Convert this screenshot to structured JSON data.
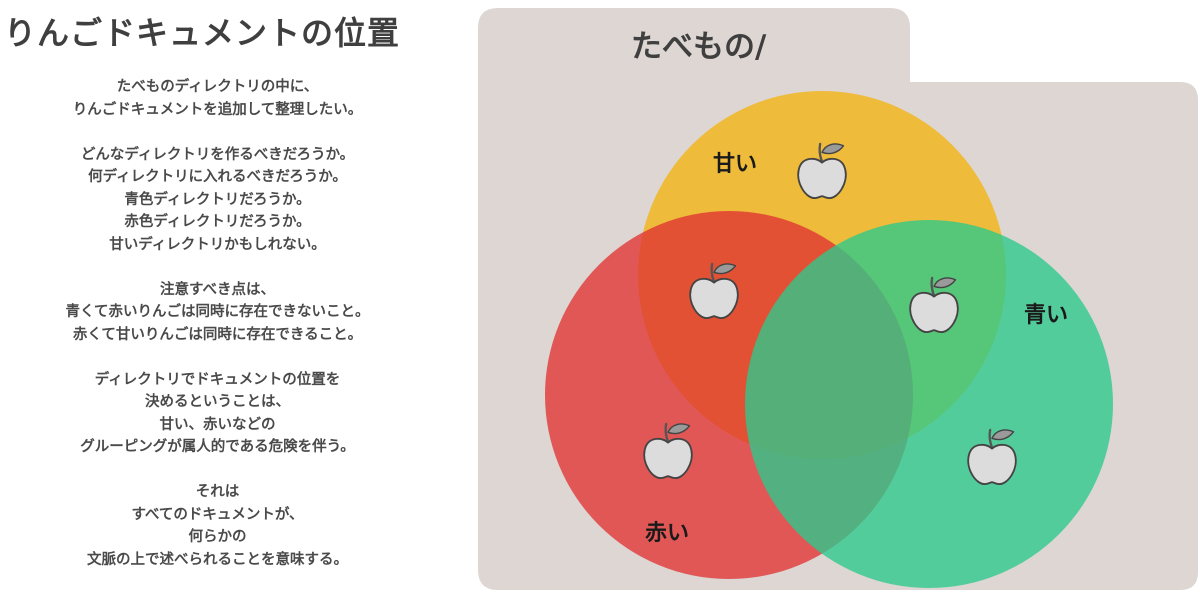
{
  "title": "りんごドキュメントの位置",
  "paragraphs": [
    [
      "たべものディレクトリの中に、",
      "りんごドキュメントを追加して整理したい。"
    ],
    [
      "どんなディレクトリを作るべきだろうか。",
      "何ディレクトリに入れるべきだろうか。",
      "青色ディレクトリだろうか。",
      "赤色ディレクトリだろうか。",
      "甘いディレクトリかもしれない。"
    ],
    [
      "注意すべき点は、",
      "青くて赤いりんごは同時に存在できないこと。",
      "赤くて甘いりんごは同時に存在できること。"
    ],
    [
      "ディレクトリでドキュメントの位置を",
      "決めるということは、",
      "甘い、赤いなどの",
      "グルーピングが属人的である危険を伴う。"
    ],
    [
      "それは",
      "すべてのドキュメントが、",
      "何らかの",
      "文脈の上で述べられることを意味する。"
    ]
  ],
  "folder": {
    "label": "たべもの/"
  },
  "sets": {
    "sweet": {
      "label": "甘い",
      "color": "#f2b418"
    },
    "red": {
      "label": "赤い",
      "color": "#e03333"
    },
    "blue": {
      "label": "青い",
      "color": "#2cc98c"
    }
  },
  "apples": [
    {
      "region": "sweet-only",
      "icon": "apple-icon"
    },
    {
      "region": "sweet-red",
      "icon": "apple-icon"
    },
    {
      "region": "sweet-blue",
      "icon": "apple-icon"
    },
    {
      "region": "red-only",
      "icon": "apple-icon"
    },
    {
      "region": "blue-only",
      "icon": "apple-icon"
    }
  ]
}
